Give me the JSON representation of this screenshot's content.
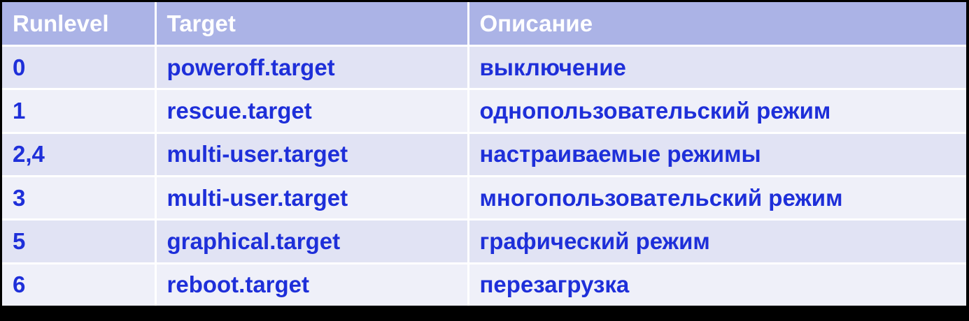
{
  "table": {
    "headers": [
      "Runlevel",
      "Target",
      "Описание"
    ],
    "rows": [
      [
        "0",
        "poweroff.target",
        "выключение"
      ],
      [
        "1",
        "rescue.target",
        "однопользовательский режим"
      ],
      [
        "2,4",
        "multi-user.target",
        "настраиваемые режимы"
      ],
      [
        "3",
        "multi-user.target",
        "многопользовательский режим"
      ],
      [
        "5",
        "graphical.target",
        "графический режим"
      ],
      [
        "6",
        "reboot.target",
        "перезагрузка"
      ]
    ]
  },
  "colors": {
    "header_bg": "#abb3e6",
    "header_text": "#ffffff",
    "row_odd_bg": "#e1e3f4",
    "row_even_bg": "#eff0f9",
    "cell_text": "#1e2fd9",
    "frame": "#000000"
  }
}
